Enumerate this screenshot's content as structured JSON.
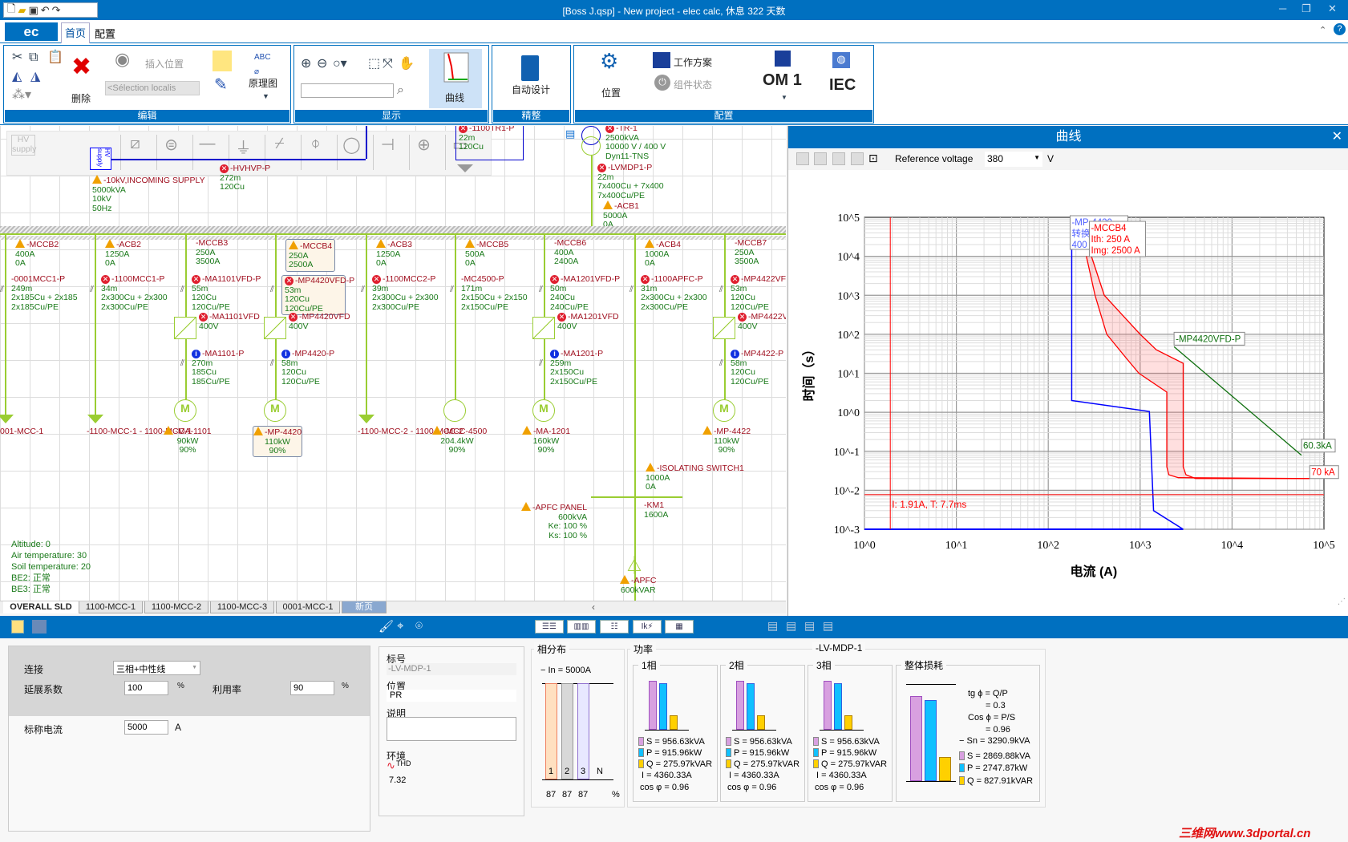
{
  "window": {
    "title": "[Boss J.qsp] - New project - elec calc, 休息 322 天数",
    "controls": [
      "─",
      "❐",
      "✕"
    ]
  },
  "ribbon_tabs": {
    "logo": "ec",
    "tabs": [
      "首页",
      "配置"
    ]
  },
  "ribbon": {
    "groups": [
      "编辑",
      "显示",
      "精整",
      "配置"
    ],
    "edit": {
      "delete": "删除",
      "insert_location": "插入位置",
      "location_select": "<Sélection localis",
      "schematic": "原理图"
    },
    "display": {
      "curves": "曲线",
      "search_value": ""
    },
    "refine": {
      "auto_design": "自动设计"
    },
    "config": {
      "location": "位置",
      "work_plan": "工作方案",
      "component_state": "组件状态",
      "om": "OM 1",
      "standard": "IEC"
    }
  },
  "sld": {
    "palette_hv_supply": "HV supply",
    "incoming": {
      "name": "-10kV,INCOMING SUPPLY",
      "lines": [
        "5000kVA",
        "10kV",
        "50Hz"
      ],
      "box": "HV supply"
    },
    "hv_cable": {
      "name": "-HVHVP-P",
      "lines": [
        "272m",
        "120Cu"
      ]
    },
    "tr_cable": {
      "name": "-1100TR1-P",
      "lines": [
        "22m",
        "120Cu"
      ]
    },
    "transformer": {
      "name": "-TR-1",
      "lines": [
        "2500kVA",
        "10000 V / 400 V",
        "Dyn11-TNS"
      ]
    },
    "lv_cable": {
      "name": "-LVMDP1-P",
      "lines": [
        "22m",
        "7x400Cu + 7x400",
        "7x400Cu/PE"
      ]
    },
    "main_breaker": {
      "name": "-ACB1",
      "lines": [
        "5000A",
        "0A"
      ]
    },
    "feeders": [
      {
        "breaker": {
          "name": "-MCCB2",
          "status": "warn",
          "lines": [
            "400A",
            "0A"
          ]
        },
        "cable": {
          "name": "-0001MCC1-P",
          "status": "",
          "lines": [
            "249m",
            "2x185Cu + 2x185",
            "2x185Cu/PE"
          ]
        },
        "end": {
          "type": "arrow",
          "name": "001-MCC-1",
          "lines": []
        }
      },
      {
        "breaker": {
          "name": "-ACB2",
          "status": "warn",
          "lines": [
            "1250A",
            "0A"
          ]
        },
        "cable": {
          "name": "-1100MCC1-P",
          "status": "err",
          "lines": [
            "34m",
            "2x300Cu + 2x300",
            "2x300Cu/PE"
          ]
        },
        "end": {
          "type": "arrow",
          "name": "-1100-MCC-1 - 1100-MCC-1",
          "lines": []
        }
      },
      {
        "breaker": {
          "name": "-MCCB3",
          "status": "",
          "lines": [
            "250A",
            "3500A"
          ]
        },
        "cable": {
          "name": "-MA1101VFD-P",
          "status": "err",
          "lines": [
            "55m",
            "120Cu",
            "120Cu/PE"
          ]
        },
        "vfd": {
          "name": "-MA1101VFD",
          "status": "err",
          "lines": [
            "400V"
          ]
        },
        "cable2": {
          "name": "-MA1101-P",
          "status": "info",
          "lines": [
            "270m",
            "185Cu",
            "185Cu/PE"
          ]
        },
        "end": {
          "type": "motor",
          "name": "-MA-1101",
          "status": "warn",
          "lines": [
            "90kW",
            "90%"
          ]
        }
      },
      {
        "selected": true,
        "breaker": {
          "name": "-MCCB4",
          "status": "warn",
          "lines": [
            "250A",
            "2500A"
          ]
        },
        "cable": {
          "name": "-MP4420VFD-P",
          "status": "err",
          "lines": [
            "53m",
            "120Cu",
            "120Cu/PE"
          ]
        },
        "vfd": {
          "name": "-MP4420VFD",
          "status": "err",
          "lines": [
            "400V"
          ]
        },
        "cable2": {
          "name": "-MP4420-P",
          "status": "info",
          "lines": [
            "58m",
            "120Cu",
            "120Cu/PE"
          ]
        },
        "end": {
          "type": "motor",
          "name": "-MP-4420",
          "status": "warn",
          "lines": [
            "110kW",
            "90%"
          ]
        }
      },
      {
        "breaker": {
          "name": "-ACB3",
          "status": "warn",
          "lines": [
            "1250A",
            "0A"
          ]
        },
        "cable": {
          "name": "-1100MCC2-P",
          "status": "err",
          "lines": [
            "39m",
            "2x300Cu + 2x300",
            "2x300Cu/PE"
          ]
        },
        "end": {
          "type": "arrow",
          "name": "-1100-MCC-2 - 1100-MCC-2",
          "lines": []
        }
      },
      {
        "breaker": {
          "name": "-MCCB5",
          "status": "warn",
          "lines": [
            "500A",
            "0A"
          ]
        },
        "cable": {
          "name": "-MC4500-P",
          "status": "",
          "lines": [
            "171m",
            "2x150Cu + 2x150",
            "2x150Cu/PE"
          ]
        },
        "end": {
          "type": "load",
          "name": "-MCC-4500",
          "status": "warn",
          "lines": [
            "204.4kW",
            "90%"
          ]
        }
      },
      {
        "breaker": {
          "name": "-MCCB6",
          "status": "",
          "lines": [
            "400A",
            "2400A"
          ]
        },
        "cable": {
          "name": "-MA1201VFD-P",
          "status": "err",
          "lines": [
            "50m",
            "240Cu",
            "240Cu/PE"
          ]
        },
        "vfd": {
          "name": "-MA1201VFD",
          "status": "err",
          "lines": [
            "400V"
          ]
        },
        "cable2": {
          "name": "-MA1201-P",
          "status": "info",
          "lines": [
            "259m",
            "2x150Cu",
            "2x150Cu/PE"
          ]
        },
        "end": {
          "type": "motor",
          "name": "-MA-1201",
          "status": "warn",
          "lines": [
            "160kW",
            "90%"
          ]
        }
      },
      {
        "breaker": {
          "name": "-ACB4",
          "status": "warn",
          "lines": [
            "1000A",
            "0A"
          ]
        },
        "cable": {
          "name": "-1100APFC-P",
          "status": "err",
          "lines": [
            "31m",
            "2x300Cu + 2x300",
            "2x300Cu/PE"
          ]
        },
        "end": {
          "type": "none"
        }
      },
      {
        "breaker": {
          "name": "-MCCB7",
          "status": "",
          "lines": [
            "250A",
            "3500A"
          ]
        },
        "cable": {
          "name": "-MP4422VFD-P",
          "status": "err",
          "lines": [
            "53m",
            "120Cu",
            "120Cu/PE"
          ]
        },
        "vfd": {
          "name": "-MP4422VFD",
          "status": "err",
          "lines": [
            "400V"
          ]
        },
        "cable2": {
          "name": "-MP4422-P",
          "status": "info",
          "lines": [
            "58m",
            "120Cu",
            "120Cu/PE"
          ]
        },
        "end": {
          "type": "motor",
          "name": "-MP-4422",
          "status": "warn",
          "lines": [
            "110kW",
            "90%"
          ]
        }
      }
    ],
    "isolating_switch": {
      "name": "-ISOLATING SWITCH1",
      "lines": [
        "1000A",
        "0A"
      ]
    },
    "contactor": {
      "name": "-KM1",
      "lines": [
        "1600A"
      ]
    },
    "apfc_panel": {
      "name": "-APFC PANEL",
      "lines": [
        "600kVA",
        "Ke: 100 %",
        "Ks: 100 %"
      ]
    },
    "apfc": {
      "name": "-APFC",
      "lines": [
        "600kVAR"
      ]
    },
    "environment": [
      "Altitude: 0",
      "Air temperature: 30",
      "Soil temperature: 20",
      "BE2: 正常",
      "BE3: 正常"
    ],
    "sheet_tabs": [
      "OVERALL SLD",
      "1100-MCC-1",
      "1100-MCC-2",
      "1100-MCC-3",
      "0001-MCC-1",
      "新页"
    ]
  },
  "curve_panel": {
    "title": "曲线",
    "ref_voltage_label": "Reference voltage",
    "ref_voltage": "380",
    "ref_voltage_unit": "V",
    "chart_data": {
      "type": "line",
      "xscale": "log",
      "yscale": "log",
      "xlabel": "电流 (A)",
      "ylabel": "时间（s）",
      "xlim": [
        1,
        100000
      ],
      "ylim": [
        0.001,
        100000
      ],
      "xticks": [
        "10^0",
        "10^1",
        "10^2",
        "10^3",
        "10^4",
        "10^5"
      ],
      "yticks": [
        "10^-3",
        "10^-2",
        "10^-1",
        "10^0",
        "10^1",
        "10^2",
        "10^3",
        "10^4",
        "10^5"
      ],
      "grid": true,
      "series": [
        {
          "name": "-MP-4420",
          "color": "#0000ff",
          "points": [
            [
              180,
              15000
            ],
            [
              180,
              2
            ],
            [
              1260,
              1.05
            ],
            [
              1400,
              0.003
            ],
            [
              2940,
              0.001
            ]
          ],
          "baseline": [
            [
              1,
              0.001
            ],
            [
              2940,
              0.001
            ]
          ],
          "label_lines": [
            "-MP-4420",
            "转换",
            "400"
          ]
        },
        {
          "name": "-MCCB4",
          "color": "#ff0000",
          "band": true,
          "lower": [
            [
              260,
              10000
            ],
            [
              323,
              1000
            ],
            [
              433,
              100
            ],
            [
              700,
              25
            ],
            [
              970,
              10
            ],
            [
              1950,
              3.3
            ],
            [
              1950,
              0.04
            ],
            [
              2050,
              0.025
            ],
            [
              2600,
              0.021
            ],
            [
              70000,
              0.02
            ]
          ],
          "upper": [
            [
              295,
              10000
            ],
            [
              407,
              1000
            ],
            [
              1000,
              100
            ],
            [
              1500,
              40
            ],
            [
              2940,
              18
            ],
            [
              2940,
              0.04
            ],
            [
              3150,
              0.025
            ],
            [
              4000,
              0.02
            ],
            [
              70000,
              0.02
            ]
          ],
          "label_lines": [
            "-MCCB4",
            "Ith: 250 A",
            "Img: 2500 A"
          ],
          "end_label": "70 kA"
        },
        {
          "name": "-MP4420VFD-P",
          "color": "#107010",
          "points": [
            [
              2340,
              48
            ],
            [
              57000,
              0.079
            ]
          ],
          "end_label": "60.3kA"
        }
      ],
      "cursor": {
        "current_A": 1.91,
        "time_s": 0.0077,
        "label": "I: 1.91A, T: 7.7ms",
        "color": "#ff0000"
      }
    }
  },
  "props": {
    "connection_label": "连接",
    "connection_value": "三相+中性线",
    "extension_label": "延展系数",
    "extension_value": "100",
    "extension_unit": "%",
    "utilization_label": "利用率",
    "utilization_value": "90",
    "utilization_unit": "%",
    "rated_current_label": "标称电流",
    "rated_current_value": "5000",
    "rated_current_unit": "A"
  },
  "info": {
    "tag_label": "标号",
    "tag_value": "-LV-MDP-1",
    "location_label": "位置",
    "location_value": "PR",
    "desc_label": "说明",
    "desc_value": "",
    "env_label": "环境",
    "thd_label": "THD",
    "thd_value": "7.32"
  },
  "phase_dist": {
    "title": "相分布",
    "in_label": "In = 5000A",
    "phases": [
      "1",
      "2",
      "3",
      "N"
    ],
    "values": [
      "87",
      "87",
      "87",
      ""
    ],
    "fill_pct": [
      87,
      87,
      87
    ],
    "unit": "%"
  },
  "power": {
    "title": "功率",
    "board": "-LV-MDP-1",
    "phases": [
      {
        "title": "1相",
        "S": "S = 956.63kVA",
        "P": "P = 915.96kW",
        "Q": "Q = 275.97kVAR",
        "I": "I = 4360.33A",
        "cos": "cos φ = 0.96"
      },
      {
        "title": "2相",
        "S": "S = 956.63kVA",
        "P": "P = 915.96kW",
        "Q": "Q = 275.97kVAR",
        "I": "I = 4360.33A",
        "cos": "cos φ = 0.96"
      },
      {
        "title": "3相",
        "S": "S = 956.63kVA",
        "P": "P = 915.96kW",
        "Q": "Q = 275.97kVAR",
        "I": "I = 4360.33A",
        "cos": "cos φ = 0.96"
      }
    ],
    "total": {
      "title": "整体损耗",
      "tg": "tg ϕ = Q/P",
      "tg_val": "= 0.3",
      "cos": "Cos ϕ = P/S",
      "cos_val": "= 0.96",
      "sn": "Sn = 3290.9kVA",
      "S": "S = 2869.88kVA",
      "P": "P = 2747.87kW",
      "Q": "Q = 827.91kVAR"
    },
    "colors": {
      "S": "#d8a0e0",
      "P": "#10c0ff",
      "Q": "#ffd000"
    }
  },
  "watermark": "三维网www.3dportal.cn"
}
